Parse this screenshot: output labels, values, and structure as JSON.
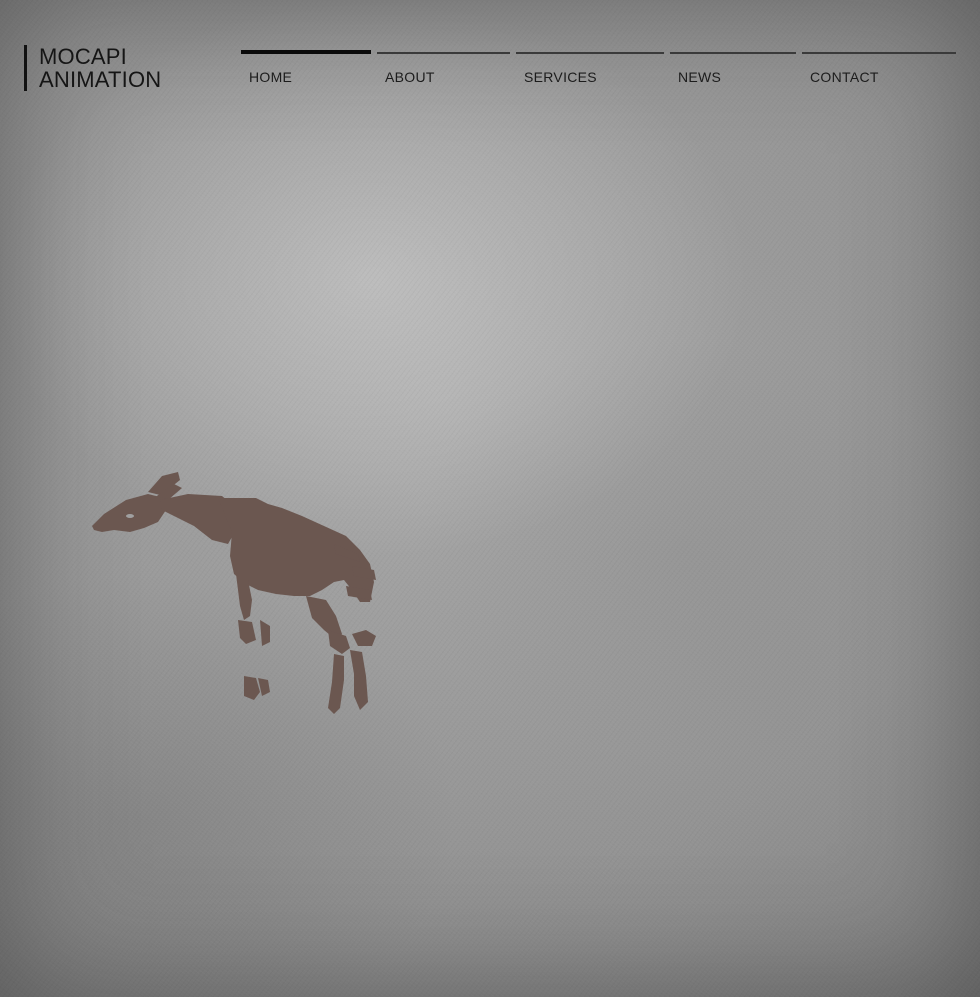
{
  "logo": {
    "line1": "MOCAPI",
    "line2": "ANIMATION"
  },
  "nav": {
    "items": [
      {
        "label": "HOME",
        "active": true
      },
      {
        "label": "ABOUT",
        "active": false
      },
      {
        "label": "SERVICES",
        "active": false
      },
      {
        "label": "NEWS",
        "active": false
      },
      {
        "label": "CONTACT",
        "active": false
      }
    ]
  },
  "theme": {
    "background": "#9a9a9a",
    "text_color": "#1c1c1c",
    "illustration_color": "#6b5750"
  },
  "illustration": {
    "icon": "okapi-illustration"
  }
}
